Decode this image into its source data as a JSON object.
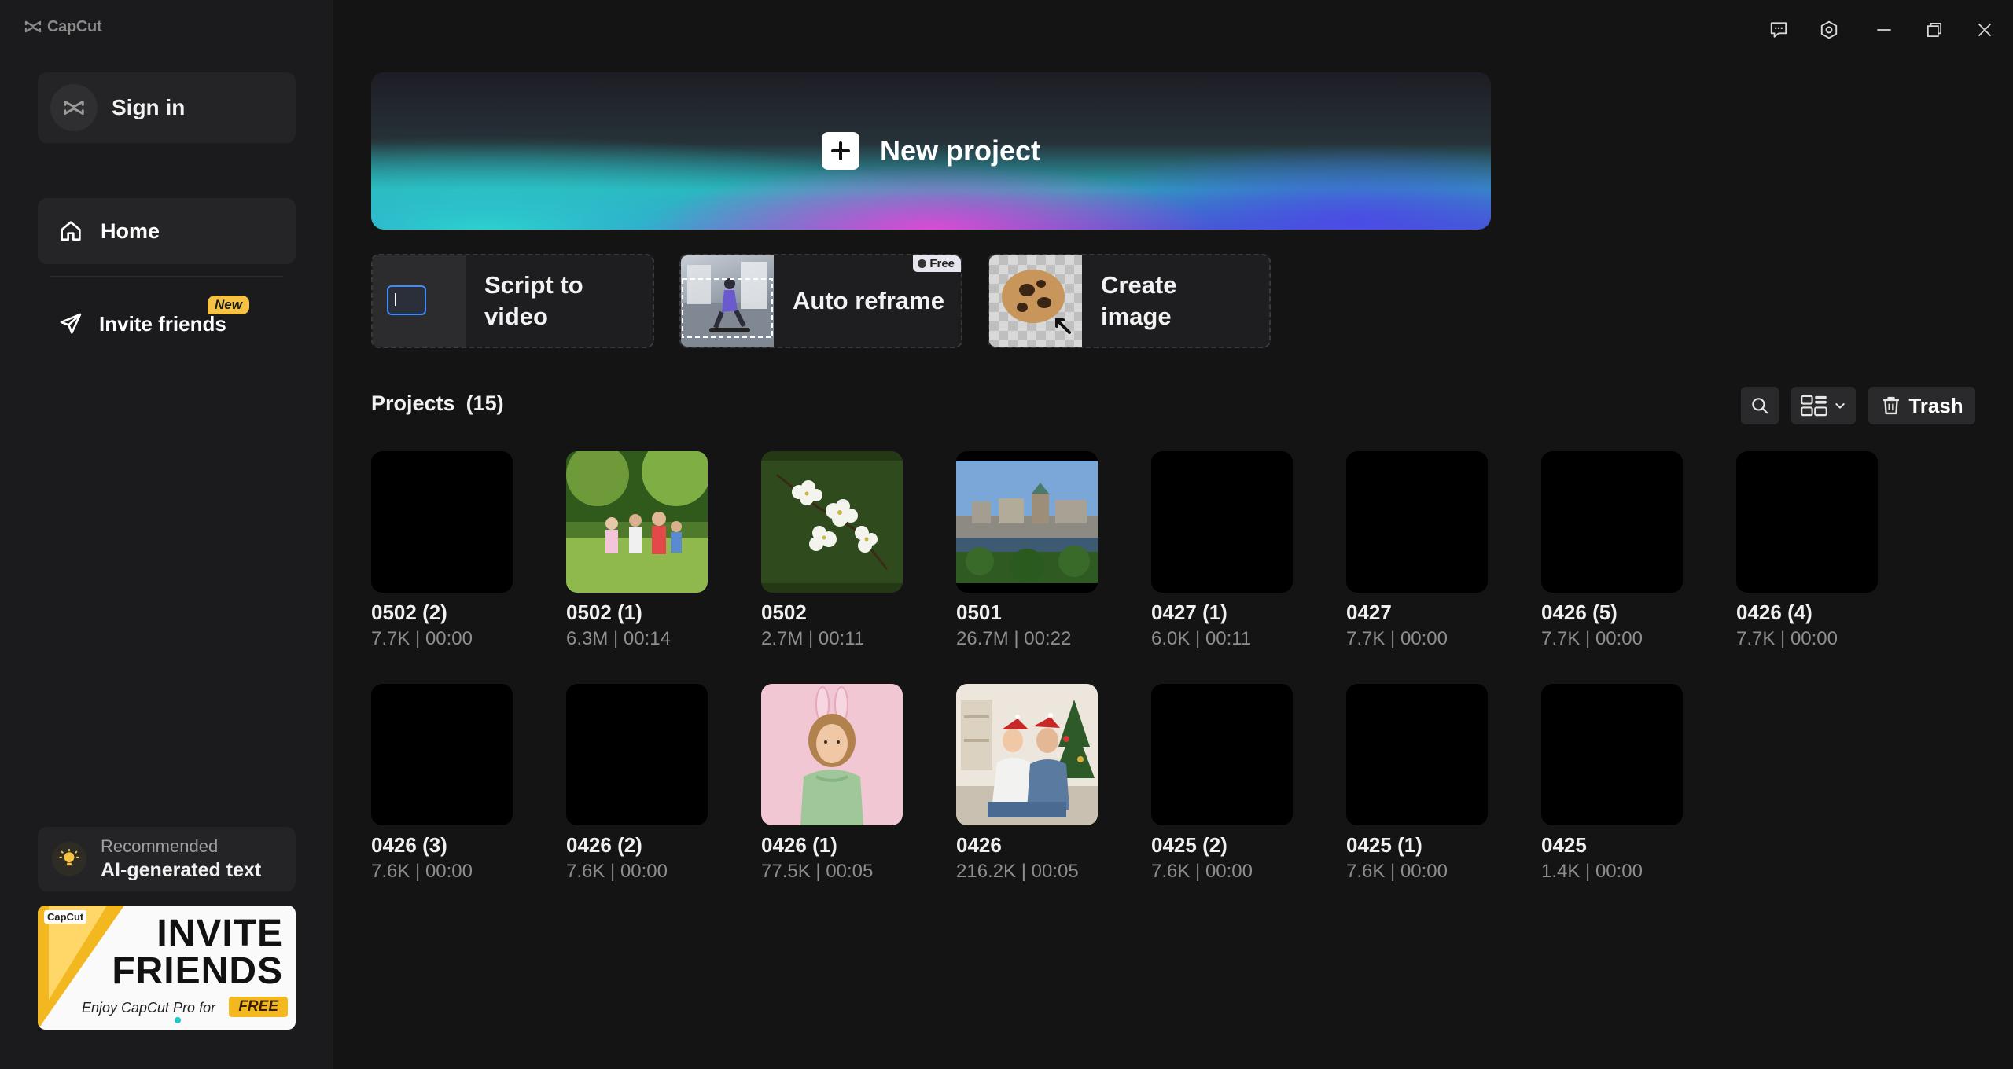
{
  "app": {
    "logo_text": "CapCut"
  },
  "sidebar": {
    "sign_in": "Sign in",
    "home": "Home",
    "invite": "Invite friends",
    "invite_badge": "New",
    "recommend_small": "Recommended",
    "recommend_big": "AI-generated text",
    "banner": {
      "logo": "CapCut",
      "line1": "INVITE",
      "line2": "FRIENDS",
      "line3": "Enjoy CapCut Pro for",
      "free": "FREE"
    }
  },
  "hero": {
    "label": "New project"
  },
  "tools": [
    {
      "label": "Script to video",
      "line1": "Script to",
      "line2": "video"
    },
    {
      "label": "Auto reframe",
      "badge": "Free"
    },
    {
      "label": "Create image",
      "line1": "Create",
      "line2": "image"
    }
  ],
  "projects": {
    "title": "Projects",
    "count": "(15)",
    "trash": "Trash",
    "items": [
      {
        "name": "0502 (2)",
        "meta": "7.7K | 00:00"
      },
      {
        "name": "0502 (1)",
        "meta": "6.3M | 00:14"
      },
      {
        "name": "0502",
        "meta": "2.7M | 00:11"
      },
      {
        "name": "0501",
        "meta": "26.7M | 00:22"
      },
      {
        "name": "0427 (1)",
        "meta": "6.0K | 00:11"
      },
      {
        "name": "0427",
        "meta": "7.7K | 00:00"
      },
      {
        "name": "0426 (5)",
        "meta": "7.7K | 00:00"
      },
      {
        "name": "0426 (4)",
        "meta": "7.7K | 00:00"
      },
      {
        "name": "0426 (3)",
        "meta": "7.6K | 00:00"
      },
      {
        "name": "0426 (2)",
        "meta": "7.6K | 00:00"
      },
      {
        "name": "0426 (1)",
        "meta": "77.5K | 00:05"
      },
      {
        "name": "0426",
        "meta": "216.2K | 00:05"
      },
      {
        "name": "0425 (2)",
        "meta": "7.6K | 00:00"
      },
      {
        "name": "0425 (1)",
        "meta": "7.6K | 00:00"
      },
      {
        "name": "0425",
        "meta": "1.4K | 00:00"
      }
    ]
  },
  "colors": {
    "bg": "#141414",
    "sidebar": "#1b1b1d",
    "accent_free": "#f3b71f",
    "badge_new": "#f6c244"
  },
  "icons": [
    "capcut-logo-icon",
    "home-icon",
    "send-icon",
    "bulb-icon",
    "feedback-icon",
    "settings-icon",
    "minimize-icon",
    "restore-icon",
    "close-icon",
    "plus-icon",
    "search-icon",
    "grid-view-icon",
    "chevron-down-icon",
    "trash-icon"
  ]
}
